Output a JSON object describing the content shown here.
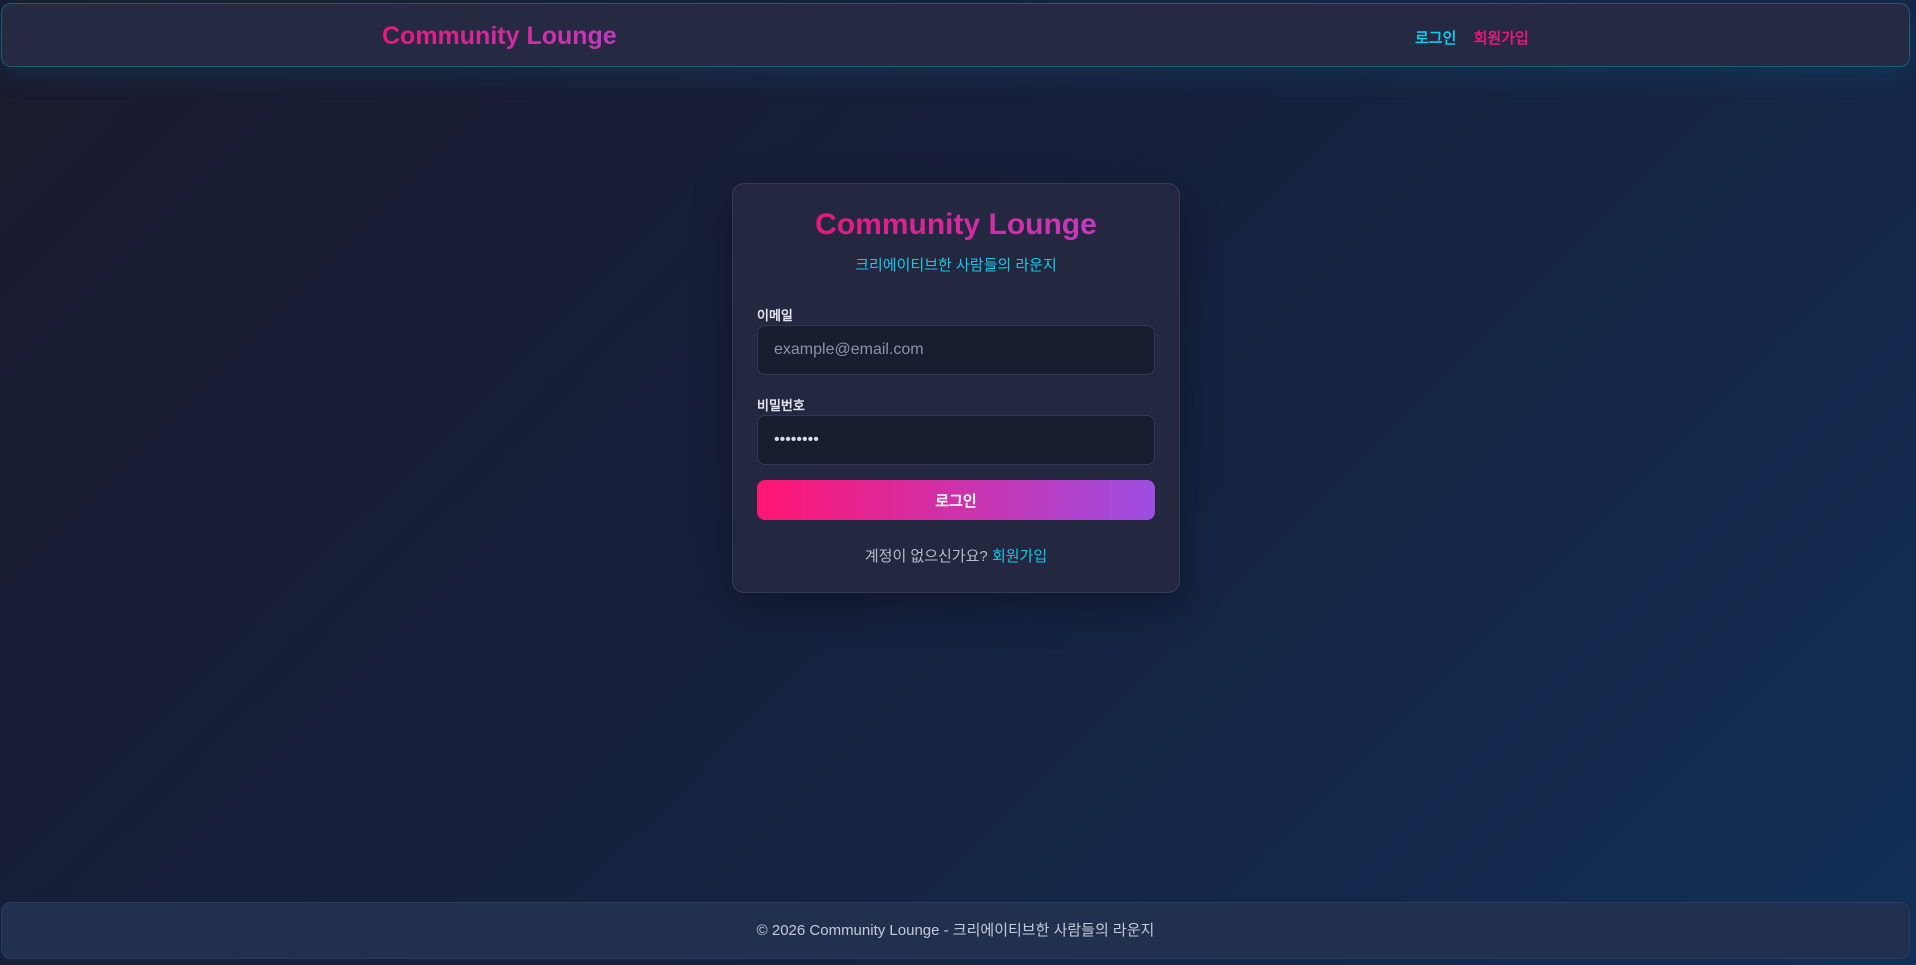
{
  "header": {
    "brand": "Community Lounge",
    "nav_login": "로그인",
    "nav_signup": "회원가입"
  },
  "card": {
    "title": "Community Lounge",
    "subtitle": "크리에이티브한 사람들의 라운지",
    "email_label": "이메일",
    "email_placeholder": "example@email.com",
    "email_value": "",
    "password_label": "비밀번호",
    "password_value": "password",
    "login_button": "로그인",
    "signup_prompt": "계정이 없으신가요?",
    "signup_link": "회원가입"
  },
  "footer": {
    "text": "© 2026 Community Lounge - 크리에이티브한 사람들의 라운지"
  },
  "colors": {
    "accent_pink": "#e6187a",
    "accent_cyan": "#16c7ea",
    "button_gradient_start": "#ff1573",
    "button_gradient_end": "#9d4ee2"
  }
}
